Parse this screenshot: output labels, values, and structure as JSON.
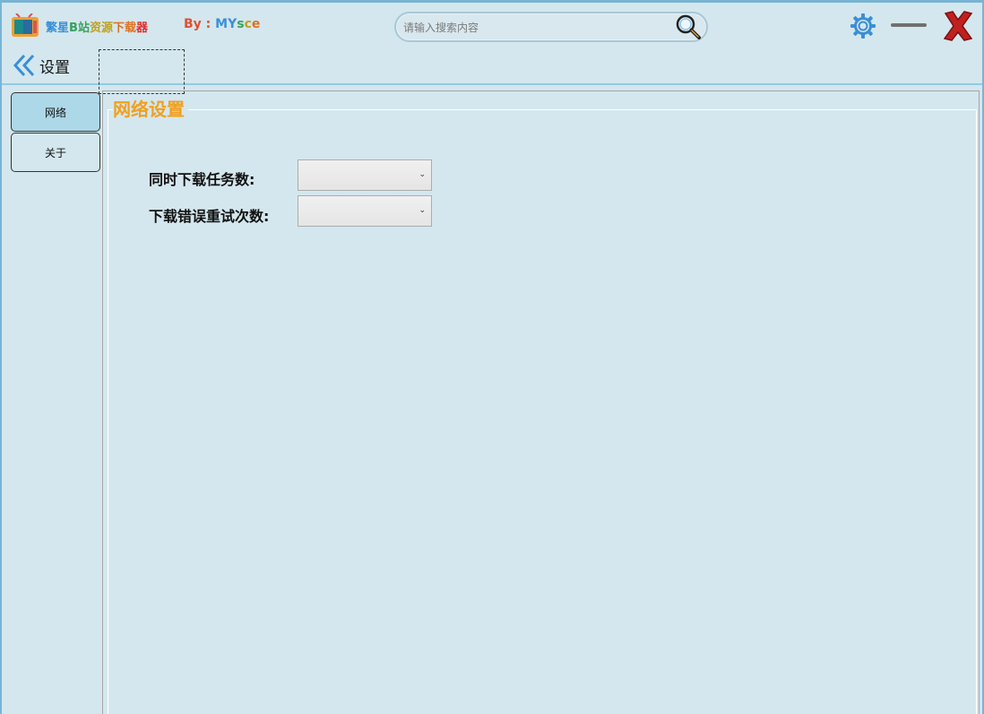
{
  "app": {
    "title_chars": [
      {
        "ch": "繁",
        "color": "#3a8fd6"
      },
      {
        "ch": "星",
        "color": "#3a8fd6"
      },
      {
        "ch": "B",
        "color": "#3aa05a"
      },
      {
        "ch": "站",
        "color": "#3aa05a"
      },
      {
        "ch": "资",
        "color": "#c0a020"
      },
      {
        "ch": "源",
        "color": "#c0a020"
      },
      {
        "ch": "下",
        "color": "#e07020"
      },
      {
        "ch": "载",
        "color": "#e07020"
      },
      {
        "ch": "器",
        "color": "#e03030"
      }
    ],
    "by_prefix": "By : ",
    "by_prefix_color": "#e05030",
    "by_chars": [
      {
        "ch": "M",
        "color": "#3a8fd6"
      },
      {
        "ch": "Y",
        "color": "#3a8fd6"
      },
      {
        "ch": "s",
        "color": "#3aa05a"
      },
      {
        "ch": "c",
        "color": "#c0a020"
      },
      {
        "ch": "e",
        "color": "#e07020"
      }
    ]
  },
  "search": {
    "placeholder": "请输入搜索内容",
    "icon": "search-icon"
  },
  "window_controls": {
    "settings_icon": "gear-icon",
    "minimize_icon": "minimize-icon",
    "close_icon": "close-icon"
  },
  "subheader": {
    "back_label": "设置",
    "back_icon": "double-chevron-left-icon"
  },
  "sidenav": {
    "items": [
      {
        "label": "网络",
        "active": true
      },
      {
        "label": "关于",
        "active": false
      }
    ]
  },
  "network": {
    "title": "网络设置",
    "title_color": "#f0a020",
    "fields": [
      {
        "label": "同时下载任务数:",
        "value": ""
      },
      {
        "label": "下载错误重试次数:",
        "value": ""
      }
    ]
  }
}
